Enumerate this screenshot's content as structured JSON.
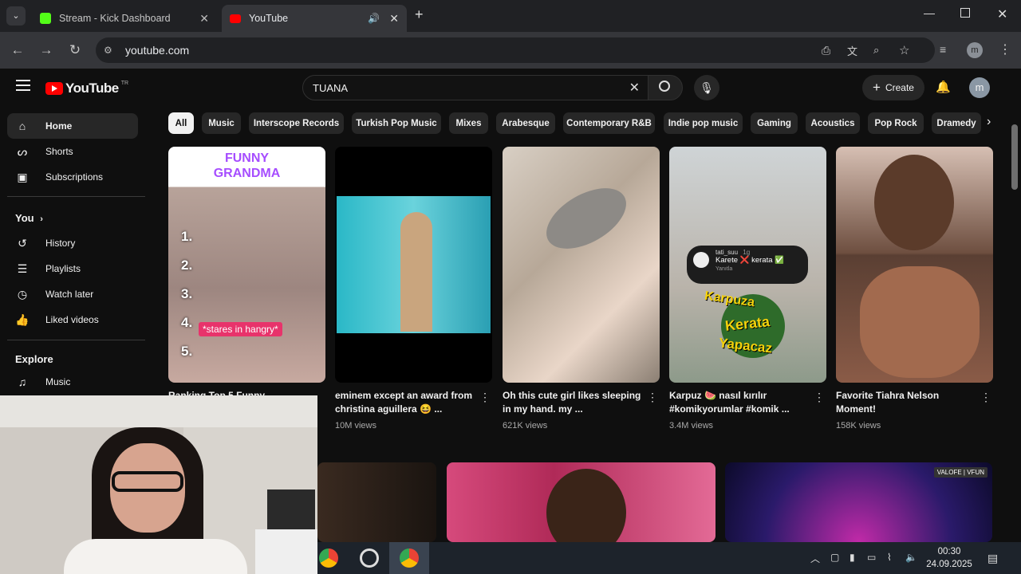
{
  "browser": {
    "tabs": [
      {
        "title": "Stream - Kick Dashboard",
        "favicon_color": "#53fc18"
      },
      {
        "title": "YouTube",
        "favicon_color": "#ff0000",
        "audio_icon": "speaker-icon"
      }
    ],
    "url": "youtube.com",
    "profile_initial": "m"
  },
  "youtube": {
    "logo_text": "YouTube",
    "country_code": "TR",
    "search_value": "TUANA",
    "create_label": "Create",
    "avatar_initial": "m",
    "sidebar": {
      "main": [
        {
          "label": "Home",
          "icon": "home-icon"
        },
        {
          "label": "Shorts",
          "icon": "shorts-icon"
        },
        {
          "label": "Subscriptions",
          "icon": "subscriptions-icon"
        }
      ],
      "you_heading": "You",
      "you": [
        {
          "label": "History",
          "icon": "history-icon"
        },
        {
          "label": "Playlists",
          "icon": "playlists-icon"
        },
        {
          "label": "Watch later",
          "icon": "watch-later-icon"
        },
        {
          "label": "Liked videos",
          "icon": "liked-icon"
        }
      ],
      "explore_heading": "Explore",
      "explore": [
        {
          "label": "Music",
          "icon": "music-icon"
        }
      ]
    },
    "chips": [
      "All",
      "Music",
      "Interscope Records",
      "Turkish Pop Music",
      "Mixes",
      "Arabesque",
      "Contemporary R&B",
      "Indie pop music",
      "Gaming",
      "Acoustics",
      "Pop Rock",
      "Dramedy"
    ],
    "videos": [
      {
        "title": "Ranking Top 5 Funny ...",
        "views": "",
        "thumb_text_top": "FUNNY",
        "thumb_text_top2": "GRANDMA",
        "thumb_caption": "*stares in hangry*"
      },
      {
        "title": "eminem except an award from christina aguillera 😆 ...",
        "views": "10M views"
      },
      {
        "title": "Oh this cute girl likes sleeping in my hand. my ...",
        "views": "621K views"
      },
      {
        "title": "Karpuz 🍉 nasıl kırılır #komikyorumlar #komik ...",
        "views": "3.4M views",
        "comment_user": "tati_suu",
        "comment_time": "1g",
        "comment_text": "Karete ❌ kerata ✅",
        "comment_reply": "Yanıtla",
        "thumb_words": [
          "Karpuza",
          "Kerata",
          "Yapacaz"
        ]
      },
      {
        "title": "Favorite Tiahra Nelson Moment!",
        "views": "158K views"
      }
    ],
    "row2_badge": "VALOFE | VFUN"
  },
  "taskbar": {
    "time": "00:30",
    "date": "24.09.2025"
  }
}
